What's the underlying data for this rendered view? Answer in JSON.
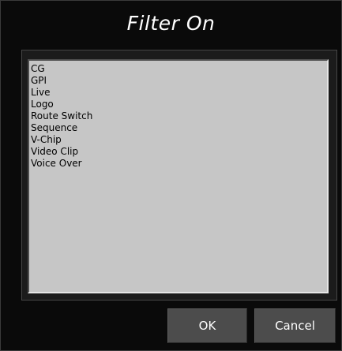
{
  "dialog": {
    "title": "Filter On",
    "items": [
      "CG",
      "GPI",
      "Live",
      "Logo",
      "Route Switch",
      "Sequence",
      "V-Chip",
      "Video Clip",
      "Voice Over"
    ],
    "ok_label": "OK",
    "cancel_label": "Cancel"
  }
}
